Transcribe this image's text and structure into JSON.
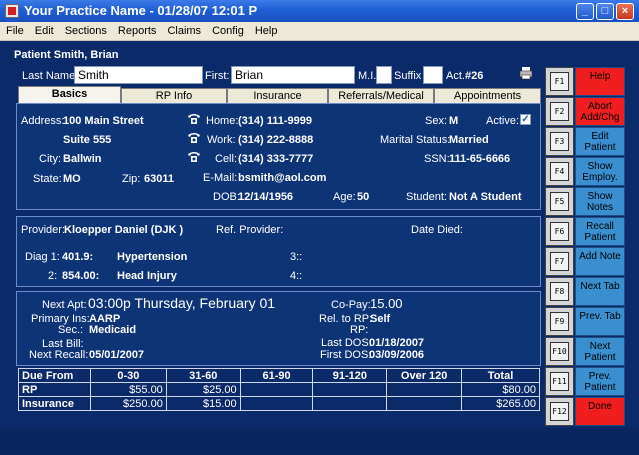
{
  "window": {
    "title": "Your Practice Name  -  01/28/07 12:01 P",
    "minimize": "_",
    "maximize": "□",
    "close": "×"
  },
  "menu": [
    "File",
    "Edit",
    "Sections",
    "Reports",
    "Claims",
    "Config",
    "Help"
  ],
  "patient": {
    "header": "Patient Smith, Brian",
    "last_name_label": "Last Name:",
    "last_name": "Smith",
    "first_label": "First:",
    "first": "Brian",
    "mi_label": "M.I.",
    "mi": "",
    "suffix_label": "Suffix",
    "suffix": "",
    "act_label": "Act.",
    "act_value": "#26"
  },
  "tabs": [
    "Basics",
    "RP Info",
    "Insurance",
    "Referrals/Medical",
    "Appointments"
  ],
  "basics": {
    "address_label": "Address:",
    "address1": "100 Main Street",
    "address2": "Suite 555",
    "city_label": "City:",
    "city": "Ballwin",
    "state_label": "State:",
    "state": "MO",
    "zip_label": "Zip:",
    "zip": "63011",
    "home_label": "Home:",
    "home": "(314) 111-9999",
    "work_label": "Work:",
    "work": "(314) 222-8888",
    "cell_label": "Cell:",
    "cell": "(314) 333-7777",
    "email_label": "E-Mail:",
    "email": "bsmith@aol.com",
    "dob_label": "DOB:",
    "dob": "12/14/1956",
    "age_label": "Age:",
    "age": "50",
    "sex_label": "Sex:",
    "sex": "M",
    "active_label": "Active:",
    "active_check": "✓",
    "marital_label": "Marital Status:",
    "marital": "Married",
    "ssn_label": "SSN:",
    "ssn": "111-65-6666",
    "student_label": "Student:",
    "student": "Not A Student"
  },
  "provider": {
    "provider_label": "Provider:",
    "provider": "Kloepper Daniel (DJK )",
    "ref_label": "Ref. Provider:",
    "ref": "",
    "died_label": "Date Died:",
    "died": "",
    "diag1_label": "Diag 1:",
    "diag1_code": "401.9:",
    "diag1_desc": "Hypertension",
    "diag2_label": "2:",
    "diag2_code": "854.00:",
    "diag2_desc": "Head Injury",
    "diag3": "3::",
    "diag4": "4::"
  },
  "account": {
    "next_apt_label": "Next Apt:",
    "next_apt": "03:00p Thursday, February 01",
    "primary_label": "Primary Ins:",
    "primary": "AARP",
    "sec_label": "Sec.:",
    "sec": "Medicaid",
    "last_bill_label": "Last Bill:",
    "last_bill": "",
    "next_recall_label": "Next Recall:",
    "next_recall": "05/01/2007",
    "copay_label": "Co-Pay:",
    "copay": "15.00",
    "rel_label": "Rel. to RP:",
    "rel": "Self",
    "rp_label": "RP:",
    "rp": "",
    "last_dos_label": "Last DOS:",
    "last_dos": "01/18/2007",
    "first_dos_label": "First DOS:",
    "first_dos": "03/09/2006"
  },
  "aging": {
    "headers": [
      "Due From",
      "0-30",
      "31-60",
      "61-90",
      "91-120",
      "Over 120",
      "Total"
    ],
    "rows": [
      [
        "RP",
        "$55.00",
        "$25.00",
        "",
        "",
        "",
        "$80.00"
      ],
      [
        "Insurance",
        "$250.00",
        "$15.00",
        "",
        "",
        "",
        "$265.00"
      ]
    ]
  },
  "fkeys": [
    {
      "key": "F1",
      "label": "Help",
      "color": "#f01e1e"
    },
    {
      "key": "F2",
      "label": "Abort Add/Chg",
      "color": "#f01e1e"
    },
    {
      "key": "F3",
      "label": "Edit Patient",
      "color": "#3a8fd0"
    },
    {
      "key": "F4",
      "label": "Show Employ.",
      "color": "#3a8fd0"
    },
    {
      "key": "F5",
      "label": "Show Notes",
      "color": "#3a8fd0"
    },
    {
      "key": "F6",
      "label": "Recall Patient",
      "color": "#3a8fd0"
    },
    {
      "key": "F7",
      "label": "Add Note",
      "color": "#3a8fd0"
    },
    {
      "key": "F8",
      "label": "Next Tab",
      "color": "#3a8fd0"
    },
    {
      "key": "F9",
      "label": "Prev. Tab",
      "color": "#3a8fd0"
    },
    {
      "key": "F10",
      "label": "Next Patient",
      "color": "#3a8fd0"
    },
    {
      "key": "F11",
      "label": "Prev. Patient",
      "color": "#3a8fd0"
    },
    {
      "key": "F12",
      "label": "Done",
      "color": "#f01e1e"
    }
  ]
}
